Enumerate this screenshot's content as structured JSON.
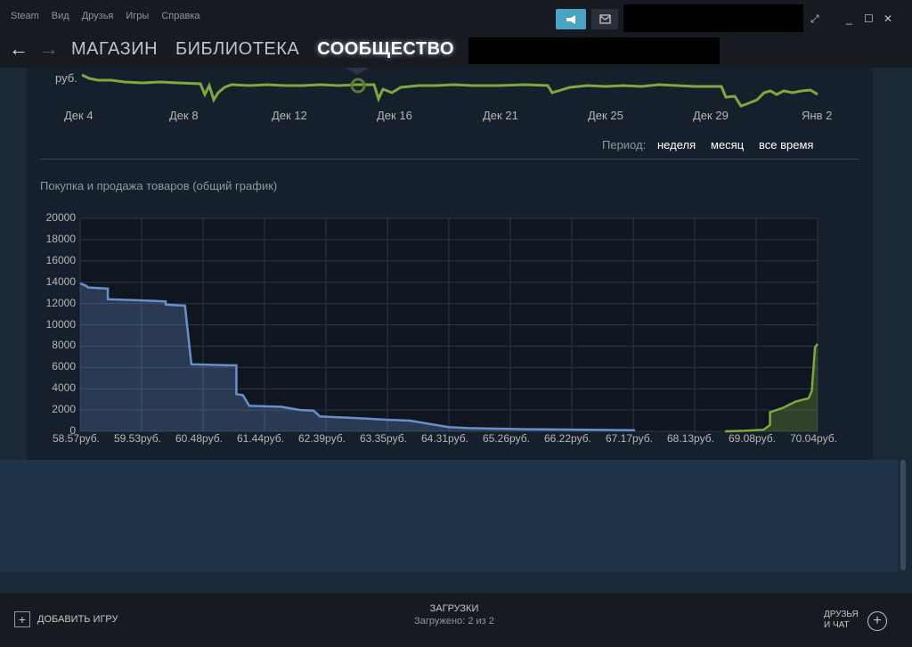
{
  "menu": [
    "Steam",
    "Вид",
    "Друзья",
    "Игры",
    "Справка"
  ],
  "nav": {
    "store": "МАГАЗИН",
    "library": "БИБЛИОТЕКА",
    "community": "СООБЩЕСТВО"
  },
  "history": {
    "unit": "руб.",
    "dates": [
      "Дек 4",
      "Дек 8",
      "Дек 12",
      "Дек 16",
      "Дек 21",
      "Дек 25",
      "Дек 29",
      "Янв 2"
    ],
    "period_label": "Период:",
    "period_options": [
      "неделя",
      "месяц",
      "все время"
    ]
  },
  "chart_title": "Покупка и продажа товаров (общий график)",
  "chart_data": {
    "type": "area",
    "title": "Покупка и продажа товаров (общий график)",
    "y_ticks": [
      0,
      2000,
      4000,
      6000,
      8000,
      10000,
      12000,
      14000,
      16000,
      18000,
      20000
    ],
    "ylim": [
      0,
      20000
    ],
    "x_ticks": [
      "58.57руб.",
      "59.53руб.",
      "60.48руб.",
      "61.44руб.",
      "62.39руб.",
      "63.35руб.",
      "64.31руб.",
      "65.26руб.",
      "66.22руб.",
      "67.17руб.",
      "68.13руб.",
      "69.08руб.",
      "70.04руб."
    ],
    "xlim": [
      58.57,
      70.04
    ],
    "series": [
      {
        "color": "#6b8fcb",
        "points": [
          [
            58.57,
            13900
          ],
          [
            58.65,
            13700
          ],
          [
            58.7,
            13500
          ],
          [
            59.0,
            13400
          ],
          [
            59.0,
            12400
          ],
          [
            59.5,
            12300
          ],
          [
            59.9,
            12200
          ],
          [
            59.9,
            11900
          ],
          [
            60.2,
            11800
          ],
          [
            60.3,
            6300
          ],
          [
            60.9,
            6200
          ],
          [
            61.0,
            6200
          ],
          [
            61.0,
            3500
          ],
          [
            61.1,
            3400
          ],
          [
            61.2,
            2400
          ],
          [
            61.7,
            2300
          ],
          [
            62.0,
            2000
          ],
          [
            62.2,
            1950
          ],
          [
            62.3,
            1400
          ],
          [
            63.0,
            1200
          ],
          [
            63.3,
            1100
          ],
          [
            63.7,
            1000
          ],
          [
            64.3,
            400
          ],
          [
            64.6,
            300
          ],
          [
            65.5,
            200
          ],
          [
            66.5,
            150
          ],
          [
            67.2,
            100
          ]
        ]
      },
      {
        "color": "#7fa83d",
        "points": [
          [
            68.6,
            0
          ],
          [
            68.9,
            50
          ],
          [
            69.2,
            150
          ],
          [
            69.3,
            600
          ],
          [
            69.3,
            1800
          ],
          [
            69.5,
            2200
          ],
          [
            69.6,
            2500
          ],
          [
            69.7,
            2800
          ],
          [
            69.9,
            3100
          ],
          [
            69.95,
            3800
          ],
          [
            70.0,
            7900
          ],
          [
            70.04,
            8200
          ]
        ]
      }
    ]
  },
  "footer": {
    "add_game": "ДОБАВИТЬ ИГРУ",
    "downloads_title": "ЗАГРУЗКИ",
    "downloads_status": "Загружено: 2 из 2",
    "friends_line1": "ДРУЗЬЯ",
    "friends_line2": "И ЧАТ"
  }
}
